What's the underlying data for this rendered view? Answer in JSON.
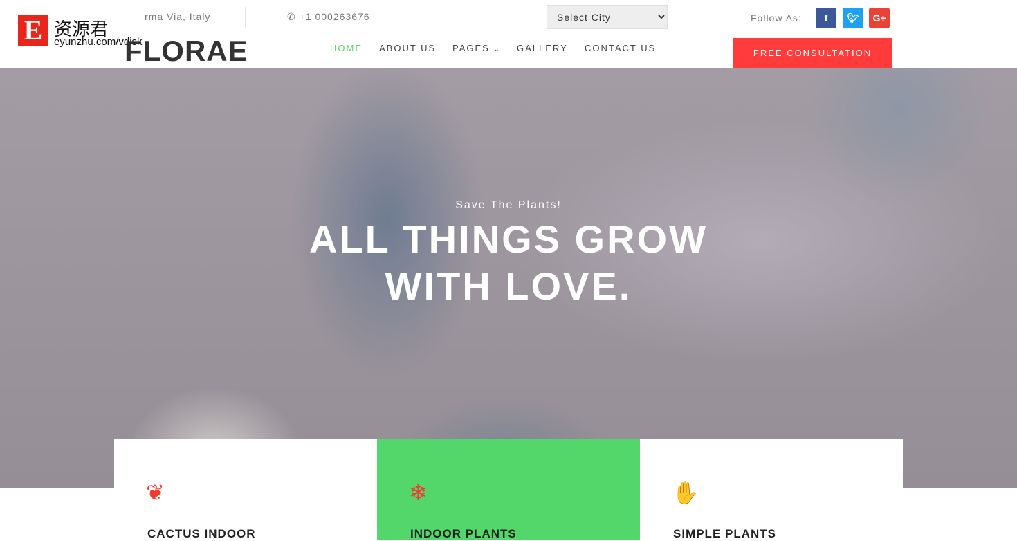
{
  "watermark": {
    "brand": "资源君",
    "url": "eyunzhu.com/vdisk",
    "letter": "E"
  },
  "topbar": {
    "address": "rma Via, Italy",
    "phone": "+1 000263676",
    "city_select": "Select City",
    "follow_label": "Follow As:"
  },
  "social": [
    {
      "icon": "facebook-icon",
      "glyph": "f",
      "color": "#3b5998"
    },
    {
      "icon": "twitter-icon",
      "glyph": "t",
      "color": "#1da1f2"
    },
    {
      "icon": "google-plus-icon",
      "glyph": "G+",
      "color": "#ea4335"
    }
  ],
  "logo": "FLORAE",
  "nav": {
    "items": [
      "HOME",
      "ABOUT US",
      "PAGES",
      "GALLERY",
      "CONTACT US"
    ],
    "active": "HOME",
    "active_color": "#5cd36a"
  },
  "cta": {
    "label": "FREE CONSULTATION",
    "color": "#ff3b3b"
  },
  "hero": {
    "subtitle": "Save The Plants!",
    "title_line1": "ALL THINGS GROW",
    "title_line2": "WITH LOVE."
  },
  "cards": [
    {
      "title": "CACTUS INDOOR",
      "icon": "leaf-icon"
    },
    {
      "title": "INDOOR PLANTS",
      "icon": "snowflake-icon",
      "bg": "#53d66a"
    },
    {
      "title": "SIMPLE PLANTS",
      "icon": "hands-plant-icon"
    }
  ]
}
